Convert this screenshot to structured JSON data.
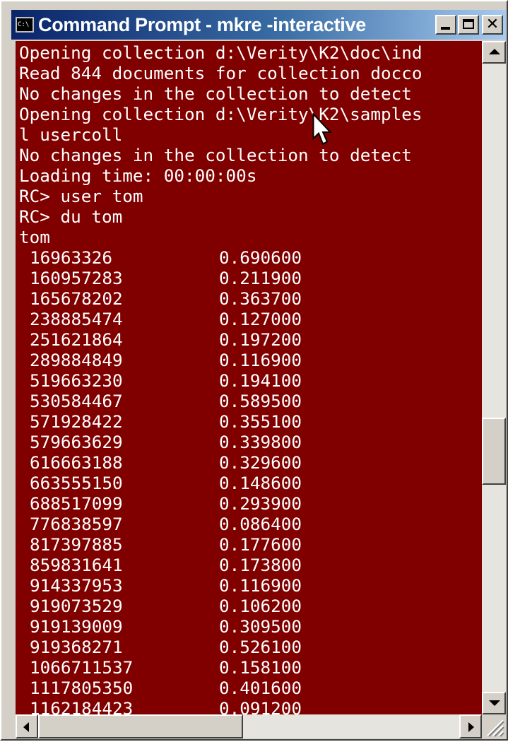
{
  "window": {
    "title": "Command Prompt - mkre -interactive",
    "icon_label": "C:\\"
  },
  "controls": {
    "minimize": "minimize-icon",
    "maximize": "maximize-icon",
    "close": "close-icon"
  },
  "console": {
    "background": "#800000",
    "foreground": "#ffffff",
    "lines": [
      "Opening collection d:\\Verity\\K2\\doc\\ind",
      "Read 844 documents for collection docco",
      "No changes in the collection to detect",
      "Opening collection d:\\Verity\\K2\\samples",
      "l usercoll",
      "No changes in the collection to detect",
      "Loading time: 00:00:00s",
      "RC> user tom",
      "RC> du tom",
      "tom"
    ],
    "rows": [
      {
        "id": "16963326",
        "value": "0.690600"
      },
      {
        "id": "160957283",
        "value": "0.211900"
      },
      {
        "id": "165678202",
        "value": "0.363700"
      },
      {
        "id": "238885474",
        "value": "0.127000"
      },
      {
        "id": "251621864",
        "value": "0.197200"
      },
      {
        "id": "289884849",
        "value": "0.116900"
      },
      {
        "id": "519663230",
        "value": "0.194100"
      },
      {
        "id": "530584467",
        "value": "0.589500"
      },
      {
        "id": "571928422",
        "value": "0.355100"
      },
      {
        "id": "579663629",
        "value": "0.339800"
      },
      {
        "id": "616663188",
        "value": "0.329600"
      },
      {
        "id": "663555150",
        "value": "0.148600"
      },
      {
        "id": "688517099",
        "value": "0.293900"
      },
      {
        "id": "776838597",
        "value": "0.086400"
      },
      {
        "id": "817397885",
        "value": "0.177600"
      },
      {
        "id": "859831641",
        "value": "0.173800"
      },
      {
        "id": "914337953",
        "value": "0.116900"
      },
      {
        "id": "919073529",
        "value": "0.106200"
      },
      {
        "id": "919139009",
        "value": "0.309500"
      },
      {
        "id": "919368271",
        "value": "0.526100"
      },
      {
        "id": "1066711537",
        "value": "0.158100"
      },
      {
        "id": "1117805350",
        "value": "0.401600"
      },
      {
        "id": "1162184423",
        "value": "0.091200"
      }
    ]
  }
}
